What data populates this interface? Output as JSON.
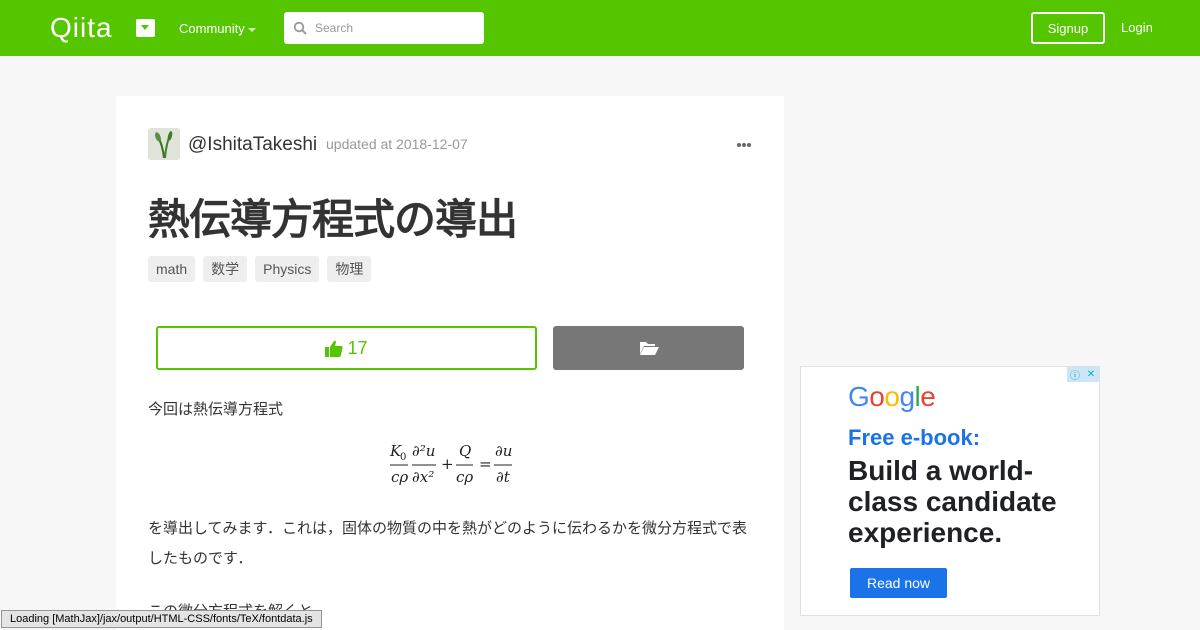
{
  "header": {
    "logo": "Qiita",
    "community_label": "Community",
    "search_placeholder": "Search",
    "signup_label": "Signup",
    "login_label": "Login"
  },
  "article": {
    "author": "@IshitaTakeshi",
    "updated": "updated at 2018-12-07",
    "title": "熱伝導方程式の導出",
    "tags": [
      "math",
      "数学",
      "Physics",
      "物理"
    ],
    "like_count": "17",
    "paragraph_1": "今回は熱伝導方程式",
    "equation": {
      "t1_num_k": "K",
      "t1_num_sub": "0",
      "t1_den": "cρ",
      "t2_num": "∂²u",
      "t2_den": "∂x²",
      "plus": "+",
      "t3_num": "Q",
      "t3_den": "cρ",
      "eq": "=",
      "t4_num": "∂u",
      "t4_den": "∂t"
    },
    "paragraph_2": "を導出してみます．これは，固体の物質の中を熱がどのように伝わるかを微分方程式で表したものです．",
    "paragraph_3": "この微分方程式を解くと，"
  },
  "status_bar": "Loading [MathJax]/jax/output/HTML-CSS/fonts/TeX/fontdata.js",
  "ad": {
    "logo": "Google",
    "subtitle": "Free e-book:",
    "headline": "Build a world-class candidate experience.",
    "cta": "Read now",
    "close_glyph": "✕",
    "info_glyph": "ⓘ"
  },
  "colors": {
    "brand_green": "#55c500",
    "google_blue": "#1a73e8"
  }
}
